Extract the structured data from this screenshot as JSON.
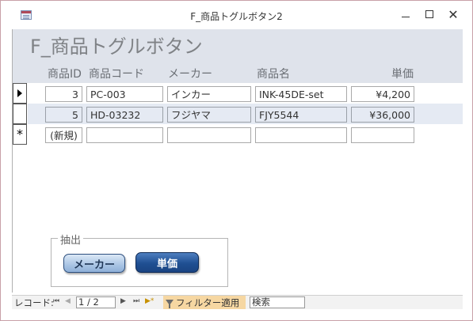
{
  "window": {
    "title": "F_商品トグルボタン2",
    "minimize_icon": "minimize-icon",
    "maximize_icon": "maximize-icon",
    "close_glyph": "✕"
  },
  "form": {
    "heading": "F_商品トグルボタン",
    "columns": {
      "id": "商品ID",
      "code": "商品コード",
      "maker": "メーカー",
      "name": "商品名",
      "price": "単価"
    },
    "rows": [
      {
        "id": "3",
        "code": "PC-003",
        "maker": "インカー",
        "name": "INK-45DE-set",
        "price": "¥4,200",
        "current": true
      },
      {
        "id": "5",
        "code": "HD-03232",
        "maker": "フジヤマ",
        "name": "FJY5544",
        "price": "¥36,000",
        "current": false
      }
    ],
    "new_row": {
      "id": "(新規)",
      "marker": "*"
    }
  },
  "filter_group": {
    "label": "抽出",
    "maker_button": "メーカー",
    "price_button": "単価",
    "active": "price"
  },
  "navigation": {
    "label": "レコード: ",
    "first_icon": "⏮",
    "prev_icon": "◀",
    "page": "1 / 2",
    "next_icon": "▶",
    "last_icon": "⏭",
    "new_icon": "▶*",
    "filter_label": "フィルター適用",
    "search_label": "検索"
  },
  "colors": {
    "header_band": "#dfe3eb",
    "alt_row": "#e5eaf3",
    "active_toggle": "#1f4f92",
    "filter_highlight": "#f6d7a2"
  }
}
